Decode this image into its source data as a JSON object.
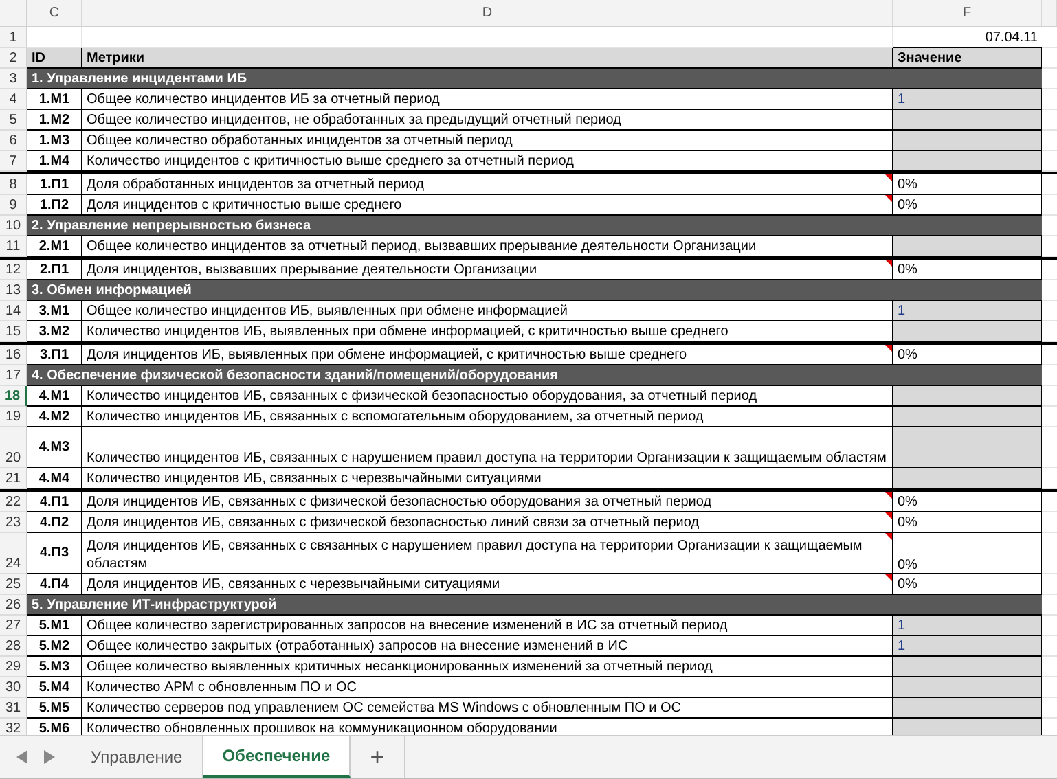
{
  "columns": [
    {
      "label": "C"
    },
    {
      "label": "D"
    },
    {
      "label": "F"
    }
  ],
  "rows": [
    {
      "number": "1",
      "kind": "date",
      "selected": false,
      "value": "07.04.11"
    },
    {
      "number": "2",
      "kind": "header",
      "selected": false,
      "id": "ID",
      "text": "Метрики",
      "value": "Значение"
    },
    {
      "number": "3",
      "kind": "section",
      "selected": false,
      "text": "1. Управление инцидентами ИБ"
    },
    {
      "number": "4",
      "kind": "metric",
      "selected": false,
      "id": "1.М1",
      "text": "Общее количество инцидентов ИБ за отчетный период",
      "value": "1",
      "input": true,
      "comment": false,
      "group_start": false,
      "tall": false
    },
    {
      "number": "5",
      "kind": "metric",
      "selected": false,
      "id": "1.М2",
      "text": "Общее количество инцидентов, не обработанных  за предыдущий отчетный период",
      "input": true,
      "comment": false,
      "group_start": false,
      "tall": false
    },
    {
      "number": "6",
      "kind": "metric",
      "selected": false,
      "id": "1.М3",
      "text": "Общее количество обработанных инцидентов за отчетный период",
      "input": true,
      "comment": false,
      "group_start": false,
      "tall": false
    },
    {
      "number": "7",
      "kind": "metric",
      "selected": false,
      "id": "1.М4",
      "text": "Количество инцидентов с критичностью выше среднего за отчетный период",
      "input": true,
      "comment": false,
      "group_start": false,
      "tall": false
    },
    {
      "number": "8",
      "kind": "metric",
      "selected": false,
      "id": "1.П1",
      "text": "Доля обработанных инцидентов за отчетный период",
      "value": "0%",
      "input": false,
      "comment": true,
      "group_start": true,
      "tall": false
    },
    {
      "number": "9",
      "kind": "metric",
      "selected": false,
      "id": "1.П2",
      "text": "Доля инцидентов с критичностью выше среднего",
      "value": "0%",
      "input": false,
      "comment": true,
      "group_start": false,
      "tall": false
    },
    {
      "number": "10",
      "kind": "section",
      "selected": false,
      "text": "2. Управление непрерывностью бизнеса"
    },
    {
      "number": "11",
      "kind": "metric",
      "selected": false,
      "id": "2.М1",
      "text": "Общее количество  инцидентов за отчетный период, вызвавших прерывание деятельности Организации",
      "input": true,
      "comment": false,
      "group_start": false,
      "tall": false
    },
    {
      "number": "12",
      "kind": "metric",
      "selected": false,
      "id": "2.П1",
      "text": "Доля  инцидентов, вызвавших прерывание деятельности Организации",
      "value": "0%",
      "input": false,
      "comment": true,
      "group_start": true,
      "tall": false
    },
    {
      "number": "13",
      "kind": "section",
      "selected": false,
      "text": "3. Обмен информацией"
    },
    {
      "number": "14",
      "kind": "metric",
      "selected": false,
      "id": "3.М1",
      "text": "Общее количество инцидентов ИБ, выявленных при обмене информацией",
      "value": "1",
      "input": true,
      "comment": false,
      "group_start": false,
      "tall": false
    },
    {
      "number": "15",
      "kind": "metric",
      "selected": false,
      "id": "3.М2",
      "text": "Количество инцидентов ИБ, выявленных при  обмене информацией, с критичностью выше среднего",
      "input": true,
      "comment": false,
      "group_start": false,
      "tall": false
    },
    {
      "number": "16",
      "kind": "metric",
      "selected": false,
      "id": "3.П1",
      "text": "Доля инцидентов ИБ, выявленных при  обмене информацией, с критичностью выше среднего",
      "value": "0%",
      "input": false,
      "comment": true,
      "group_start": true,
      "tall": false
    },
    {
      "number": "17",
      "kind": "section",
      "selected": false,
      "text": "4. Обеспечение физической безопасности зданий/помещений/оборудования"
    },
    {
      "number": "18",
      "kind": "metric",
      "selected": true,
      "id": "4.М1",
      "text": "Количество инцидентов ИБ, связанных с физической безопасностью оборудования, за отчетный период",
      "input": true,
      "comment": false,
      "group_start": false,
      "tall": false
    },
    {
      "number": "19",
      "kind": "metric",
      "selected": false,
      "id": "4.М2",
      "text": "Количество инцидентов ИБ, связанных с вспомогательным оборудованием, за отчетный период",
      "input": true,
      "comment": false,
      "group_start": false,
      "tall": false
    },
    {
      "number": "20",
      "kind": "metric",
      "selected": false,
      "id": "4.М3",
      "text": "Количество инцидентов ИБ, связанных с нарушением правил доступа на территории Организации к защищаемым областям",
      "input": true,
      "comment": false,
      "group_start": false,
      "tall": true
    },
    {
      "number": "21",
      "kind": "metric",
      "selected": false,
      "id": "4.М4",
      "text": "Количество инцидентов ИБ, связанных с черезвычайными ситуациями",
      "input": true,
      "comment": false,
      "group_start": false,
      "tall": false
    },
    {
      "number": "22",
      "kind": "metric",
      "selected": false,
      "id": "4.П1",
      "text": "Доля инцидентов ИБ, связанных с физической безопасностью оборудования за отчетный период",
      "value": "0%",
      "input": false,
      "comment": true,
      "group_start": true,
      "tall": false
    },
    {
      "number": "23",
      "kind": "metric",
      "selected": false,
      "id": "4.П2",
      "text": "Доля инцидентов ИБ, связанных с физической безопасностью линий связи за отчетный период",
      "value": "0%",
      "input": false,
      "comment": true,
      "group_start": false,
      "tall": false
    },
    {
      "number": "24",
      "kind": "metric",
      "selected": false,
      "id": "4.П3",
      "text": "Доля инцидентов ИБ, связанных с связанных с нарушением правил доступа на территории Организации к защищаемым областям",
      "value": "0%",
      "input": false,
      "comment": true,
      "group_start": false,
      "tall": true
    },
    {
      "number": "25",
      "kind": "metric",
      "selected": false,
      "id": "4.П4",
      "text": "Доля инцидентов ИБ, связанных с черезвычайными ситуациями",
      "value": "0%",
      "input": false,
      "comment": true,
      "group_start": false,
      "tall": false
    },
    {
      "number": "26",
      "kind": "section",
      "selected": false,
      "text": "5. Управление ИТ-инфраструктурой"
    },
    {
      "number": "27",
      "kind": "metric",
      "selected": false,
      "id": "5.М1",
      "text": "Общее количество зарегистрированных запросов на внесение изменений в ИС за отчетный период",
      "value": "1",
      "input": true,
      "comment": false,
      "group_start": false,
      "tall": false
    },
    {
      "number": "28",
      "kind": "metric",
      "selected": false,
      "id": "5.М2",
      "text": "Общее количество закрытых (отработанных) запросов на внесение изменений в ИС",
      "value": "1",
      "input": true,
      "comment": false,
      "group_start": false,
      "tall": false
    },
    {
      "number": "29",
      "kind": "metric",
      "selected": false,
      "id": "5.М3",
      "text": "Общее количество выявленных критичных несанкционированных изменений за отчетный период",
      "input": true,
      "comment": false,
      "group_start": false,
      "tall": false
    },
    {
      "number": "30",
      "kind": "metric",
      "selected": false,
      "id": "5.М4",
      "text": "Количество АРМ с обновленным ПО и ОС",
      "input": true,
      "comment": false,
      "group_start": false,
      "tall": false
    },
    {
      "number": "31",
      "kind": "metric",
      "selected": false,
      "id": "5.М5",
      "text": "Количество серверов под управлением ОС семейства  MS Windows с  обновленным ПО и ОС",
      "input": true,
      "comment": false,
      "group_start": false,
      "tall": false
    },
    {
      "number": "32",
      "kind": "metric",
      "selected": false,
      "id": "5.М6",
      "text": "Количество обновленных прошивок на коммуникационном оборудовании",
      "input": true,
      "comment": false,
      "group_start": false,
      "tall": false
    }
  ],
  "tabs": [
    {
      "label": "Управление",
      "selected": false
    },
    {
      "label": "Обеспечение",
      "selected": true
    }
  ],
  "add_tab": "+"
}
